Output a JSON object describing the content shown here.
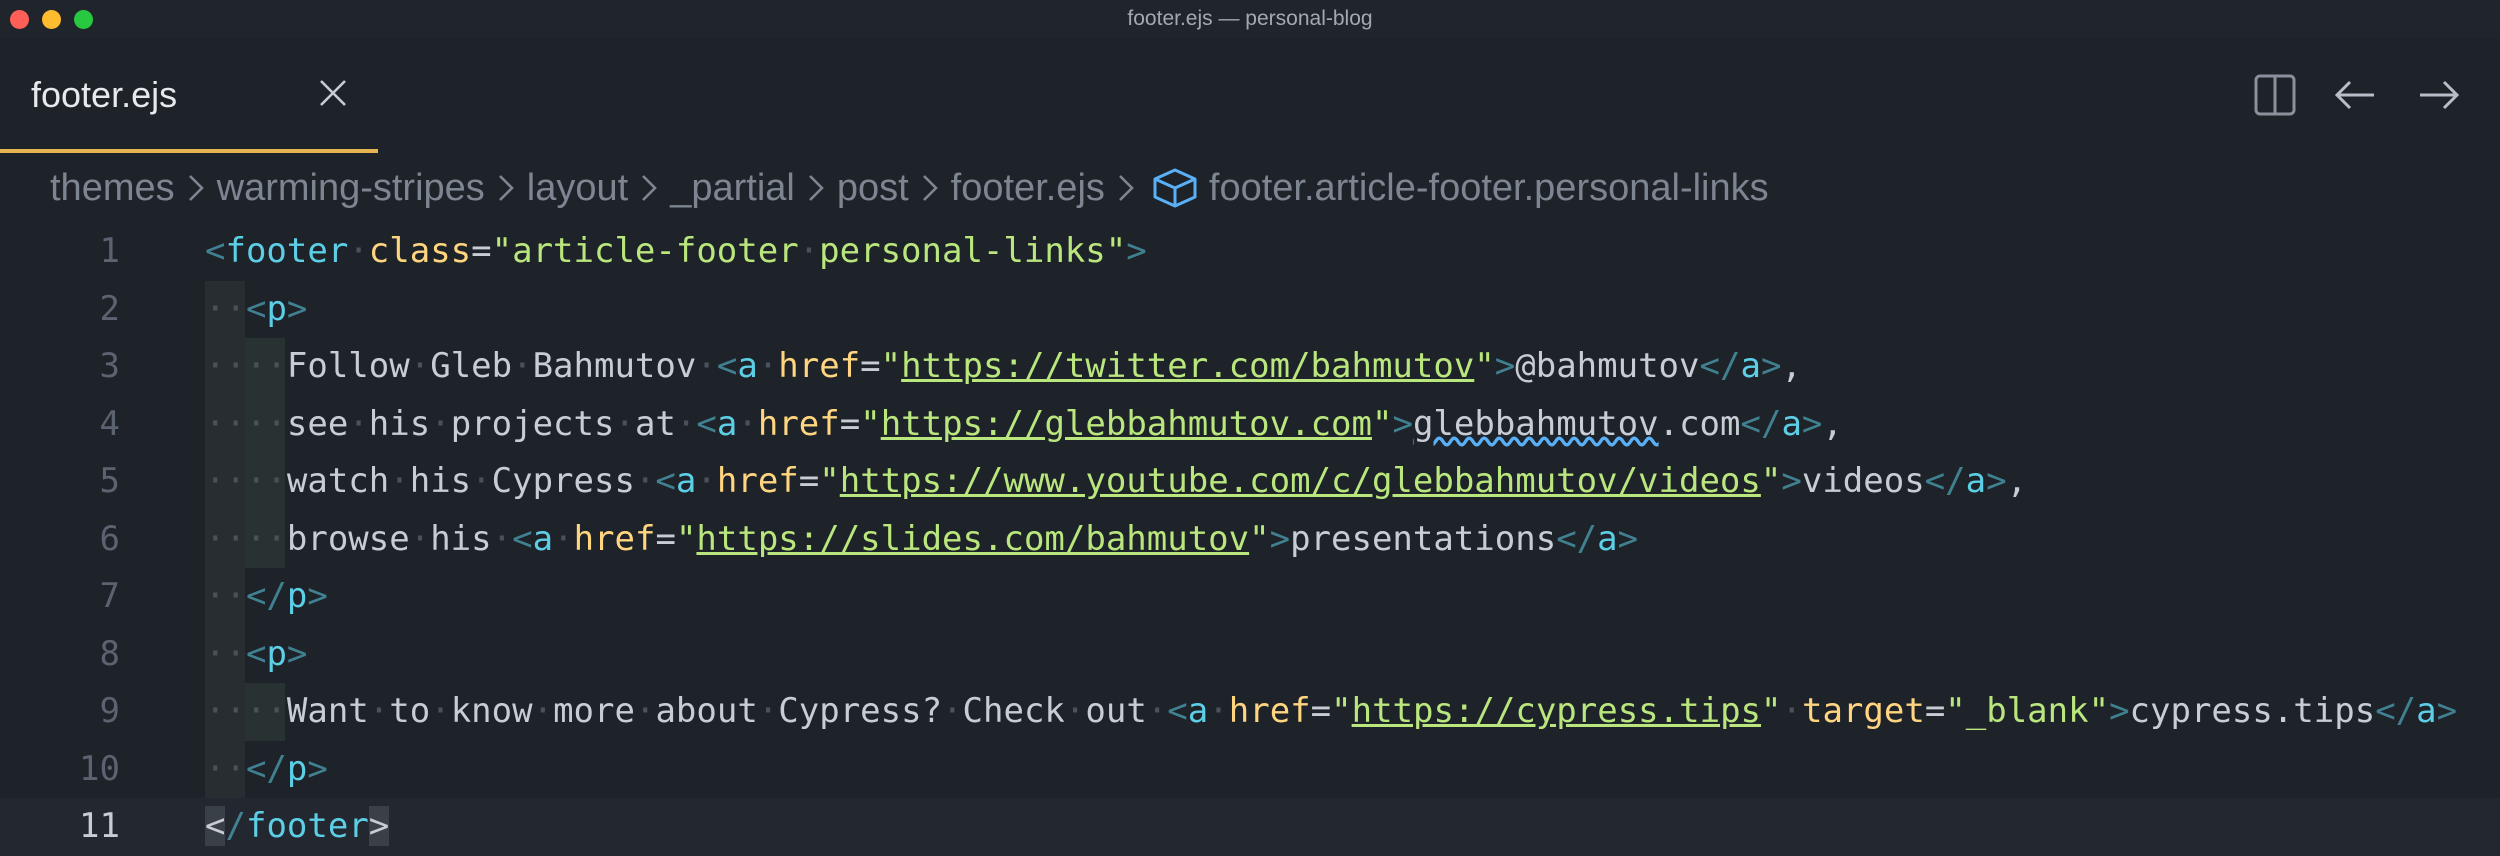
{
  "window": {
    "title": "footer.ejs — personal-blog"
  },
  "tab": {
    "label": "footer.ejs"
  },
  "icons": {
    "close_tab": "close-icon",
    "split": "split-editor-icon",
    "back": "arrow-left-icon",
    "forward": "arrow-right-icon",
    "symbol": "cube-symbol-icon"
  },
  "breadcrumb": [
    "themes",
    "warming-stripes",
    "layout",
    "_partial",
    "post",
    "footer.ejs",
    "footer.article-footer.personal-links"
  ],
  "colors": {
    "accent": "#e6b450",
    "tag": "#5ccfe6",
    "attribute": "#ffd580",
    "string": "#bae67e",
    "squiggle": "#5ab0f6"
  },
  "editor": {
    "current_line": 11,
    "lines": [
      {
        "n": "1",
        "indent": 0,
        "tokens": [
          [
            "p",
            "<"
          ],
          [
            "t",
            "footer"
          ],
          [
            "ws",
            "·"
          ],
          [
            "a",
            "class"
          ],
          [
            "txt",
            "="
          ],
          [
            "s",
            "\"article-footer"
          ],
          [
            "ws",
            "·"
          ],
          [
            "s",
            "personal-links\""
          ],
          [
            "p",
            ">"
          ]
        ]
      },
      {
        "n": "2",
        "indent": 1,
        "tokens": [
          [
            "ws",
            "··"
          ],
          [
            "p",
            "<"
          ],
          [
            "t",
            "p"
          ],
          [
            "p",
            ">"
          ]
        ]
      },
      {
        "n": "3",
        "indent": 2,
        "tokens": [
          [
            "ws",
            "····"
          ],
          [
            "txt",
            "Follow"
          ],
          [
            "ws",
            "·"
          ],
          [
            "txt",
            "Gleb"
          ],
          [
            "ws",
            "·"
          ],
          [
            "txt",
            "Bahmutov"
          ],
          [
            "ws",
            "·"
          ],
          [
            "p",
            "<"
          ],
          [
            "t",
            "a"
          ],
          [
            "ws",
            "·"
          ],
          [
            "a",
            "href"
          ],
          [
            "txt",
            "="
          ],
          [
            "s",
            "\""
          ],
          [
            "u",
            "https://twitter.com/bahmutov"
          ],
          [
            "s",
            "\""
          ],
          [
            "p",
            ">"
          ],
          [
            "txt",
            "@bahmutov"
          ],
          [
            "p",
            "</"
          ],
          [
            "t",
            "a"
          ],
          [
            "p",
            ">"
          ],
          [
            "txt",
            ","
          ]
        ]
      },
      {
        "n": "4",
        "indent": 2,
        "tokens": [
          [
            "ws",
            "····"
          ],
          [
            "txt",
            "see"
          ],
          [
            "ws",
            "·"
          ],
          [
            "txt",
            "his"
          ],
          [
            "ws",
            "·"
          ],
          [
            "txt",
            "projects"
          ],
          [
            "ws",
            "·"
          ],
          [
            "txt",
            "at"
          ],
          [
            "ws",
            "·"
          ],
          [
            "p",
            "<"
          ],
          [
            "t",
            "a"
          ],
          [
            "ws",
            "·"
          ],
          [
            "a",
            "href"
          ],
          [
            "txt",
            "="
          ],
          [
            "s",
            "\""
          ],
          [
            "u",
            "https://glebbahmutov.com"
          ],
          [
            "s",
            "\""
          ],
          [
            "p",
            ">"
          ],
          [
            "sq",
            "glebbahmutov"
          ],
          [
            "txt",
            ".com"
          ],
          [
            "p",
            "</"
          ],
          [
            "t",
            "a"
          ],
          [
            "p",
            ">"
          ],
          [
            "txt",
            ","
          ]
        ]
      },
      {
        "n": "5",
        "indent": 2,
        "tokens": [
          [
            "ws",
            "····"
          ],
          [
            "txt",
            "watch"
          ],
          [
            "ws",
            "·"
          ],
          [
            "txt",
            "his"
          ],
          [
            "ws",
            "·"
          ],
          [
            "txt",
            "Cypress"
          ],
          [
            "ws",
            "·"
          ],
          [
            "p",
            "<"
          ],
          [
            "t",
            "a"
          ],
          [
            "ws",
            "·"
          ],
          [
            "a",
            "href"
          ],
          [
            "txt",
            "="
          ],
          [
            "s",
            "\""
          ],
          [
            "u",
            "https://www.youtube.com/c/glebbahmutov/videos"
          ],
          [
            "s",
            "\""
          ],
          [
            "p",
            ">"
          ],
          [
            "txt",
            "videos"
          ],
          [
            "p",
            "</"
          ],
          [
            "t",
            "a"
          ],
          [
            "p",
            ">"
          ],
          [
            "txt",
            ","
          ]
        ]
      },
      {
        "n": "6",
        "indent": 2,
        "tokens": [
          [
            "ws",
            "····"
          ],
          [
            "txt",
            "browse"
          ],
          [
            "ws",
            "·"
          ],
          [
            "txt",
            "his"
          ],
          [
            "ws",
            "·"
          ],
          [
            "p",
            "<"
          ],
          [
            "t",
            "a"
          ],
          [
            "ws",
            "·"
          ],
          [
            "a",
            "href"
          ],
          [
            "txt",
            "="
          ],
          [
            "s",
            "\""
          ],
          [
            "u",
            "https://slides.com/bahmutov"
          ],
          [
            "s",
            "\""
          ],
          [
            "p",
            ">"
          ],
          [
            "txt",
            "presentations"
          ],
          [
            "p",
            "</"
          ],
          [
            "t",
            "a"
          ],
          [
            "p",
            ">"
          ]
        ]
      },
      {
        "n": "7",
        "indent": 1,
        "tokens": [
          [
            "ws",
            "··"
          ],
          [
            "p",
            "</"
          ],
          [
            "t",
            "p"
          ],
          [
            "p",
            ">"
          ]
        ]
      },
      {
        "n": "8",
        "indent": 1,
        "tokens": [
          [
            "ws",
            "··"
          ],
          [
            "p",
            "<"
          ],
          [
            "t",
            "p"
          ],
          [
            "p",
            ">"
          ]
        ]
      },
      {
        "n": "9",
        "indent": 2,
        "tokens": [
          [
            "ws",
            "····"
          ],
          [
            "txt",
            "Want"
          ],
          [
            "ws",
            "·"
          ],
          [
            "txt",
            "to"
          ],
          [
            "ws",
            "·"
          ],
          [
            "txt",
            "know"
          ],
          [
            "ws",
            "·"
          ],
          [
            "txt",
            "more"
          ],
          [
            "ws",
            "·"
          ],
          [
            "txt",
            "about"
          ],
          [
            "ws",
            "·"
          ],
          [
            "txt",
            "Cypress?"
          ],
          [
            "ws",
            "·"
          ],
          [
            "txt",
            "Check"
          ],
          [
            "ws",
            "·"
          ],
          [
            "txt",
            "out"
          ],
          [
            "ws",
            "·"
          ],
          [
            "p",
            "<"
          ],
          [
            "t",
            "a"
          ],
          [
            "ws",
            "·"
          ],
          [
            "a",
            "href"
          ],
          [
            "txt",
            "="
          ],
          [
            "s",
            "\""
          ],
          [
            "u",
            "https://cypress.tips"
          ],
          [
            "s",
            "\""
          ],
          [
            "ws",
            "·"
          ],
          [
            "a",
            "target"
          ],
          [
            "txt",
            "="
          ],
          [
            "s",
            "\"_blank\""
          ],
          [
            "p",
            ">"
          ],
          [
            "txt",
            "cypress.tips"
          ],
          [
            "p",
            "</"
          ],
          [
            "t",
            "a"
          ],
          [
            "p",
            ">"
          ]
        ]
      },
      {
        "n": "10",
        "indent": 1,
        "tokens": [
          [
            "ws",
            "··"
          ],
          [
            "p",
            "</"
          ],
          [
            "t",
            "p"
          ],
          [
            "p",
            ">"
          ]
        ]
      },
      {
        "n": "11",
        "indent": 0,
        "tokens": [
          [
            "bm",
            "<"
          ],
          [
            "p",
            "/"
          ],
          [
            "t",
            "footer"
          ],
          [
            "bm",
            ">"
          ]
        ]
      }
    ]
  }
}
